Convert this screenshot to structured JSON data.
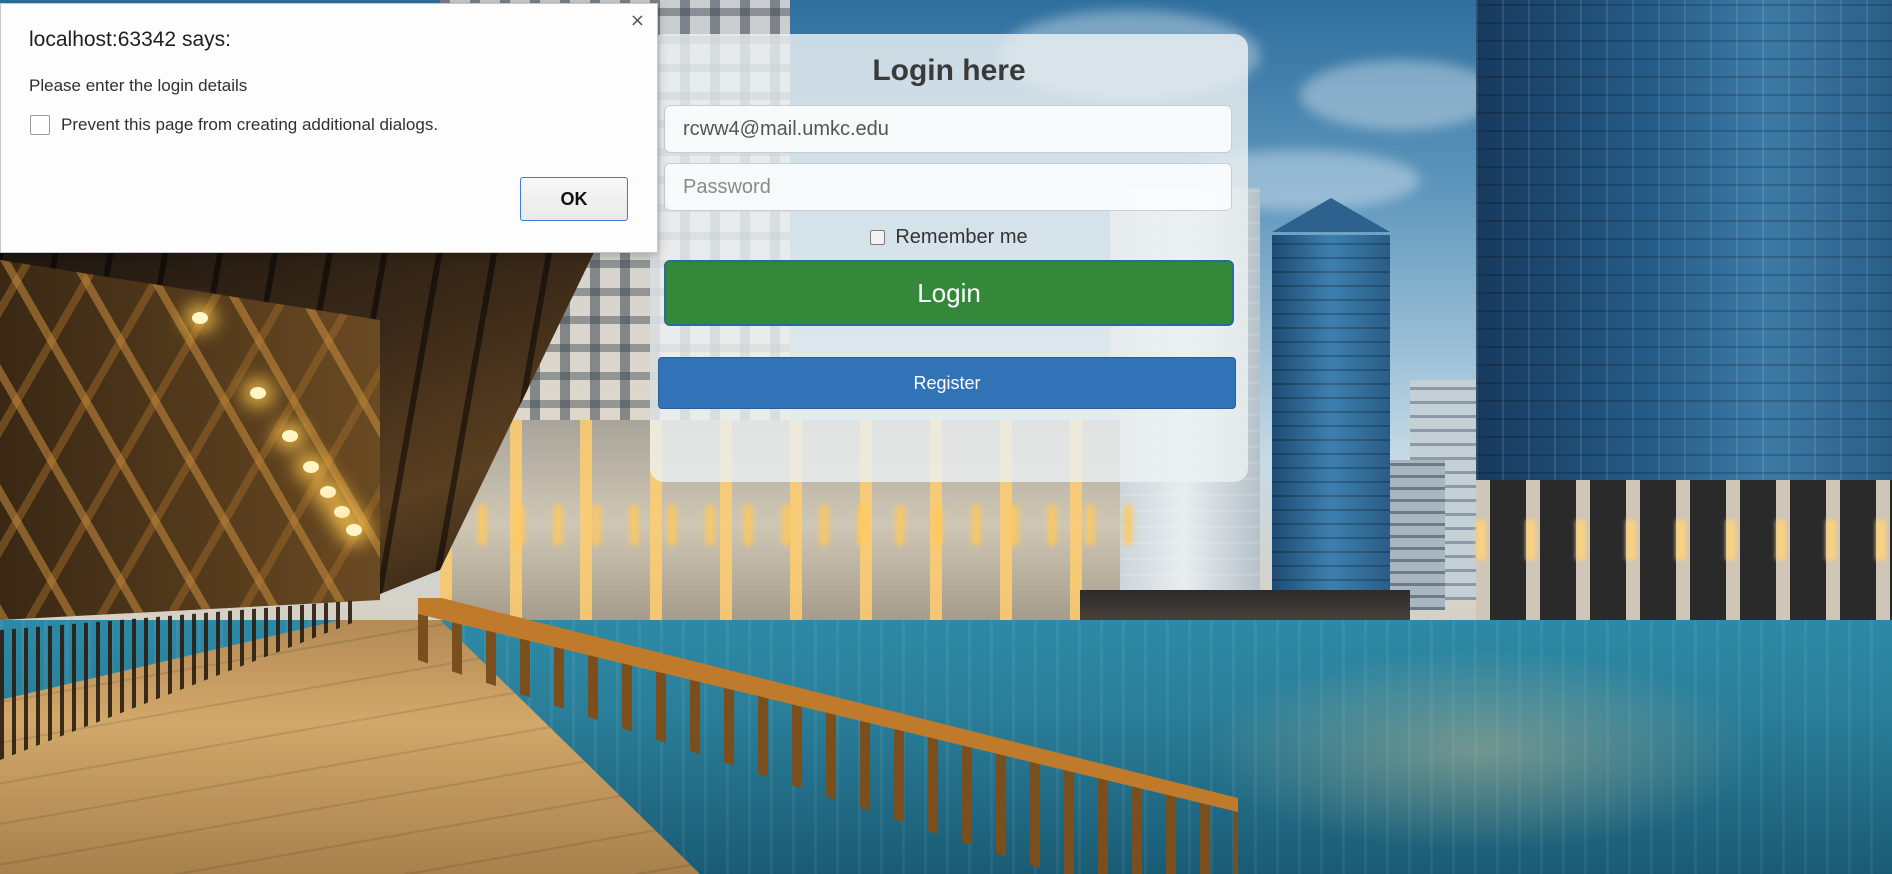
{
  "alert": {
    "title": "localhost:63342 says:",
    "message": "Please enter the login details",
    "prevent_label": "Prevent this page from creating additional dialogs.",
    "prevent_checked": false,
    "ok_label": "OK",
    "close_glyph": "×"
  },
  "login": {
    "title": "Login here",
    "email_value": "rcww4@mail.umkc.edu",
    "password_placeholder": "Password",
    "remember_label": "Remember me",
    "remember_checked": false,
    "login_button": "Login",
    "register_button": "Register"
  },
  "colors": {
    "login_green": "#33883a",
    "register_blue": "#3272b6",
    "ok_focus_border": "#3d7bd6"
  },
  "icons": {
    "close": "close-icon",
    "checkbox": "checkbox-icon"
  }
}
